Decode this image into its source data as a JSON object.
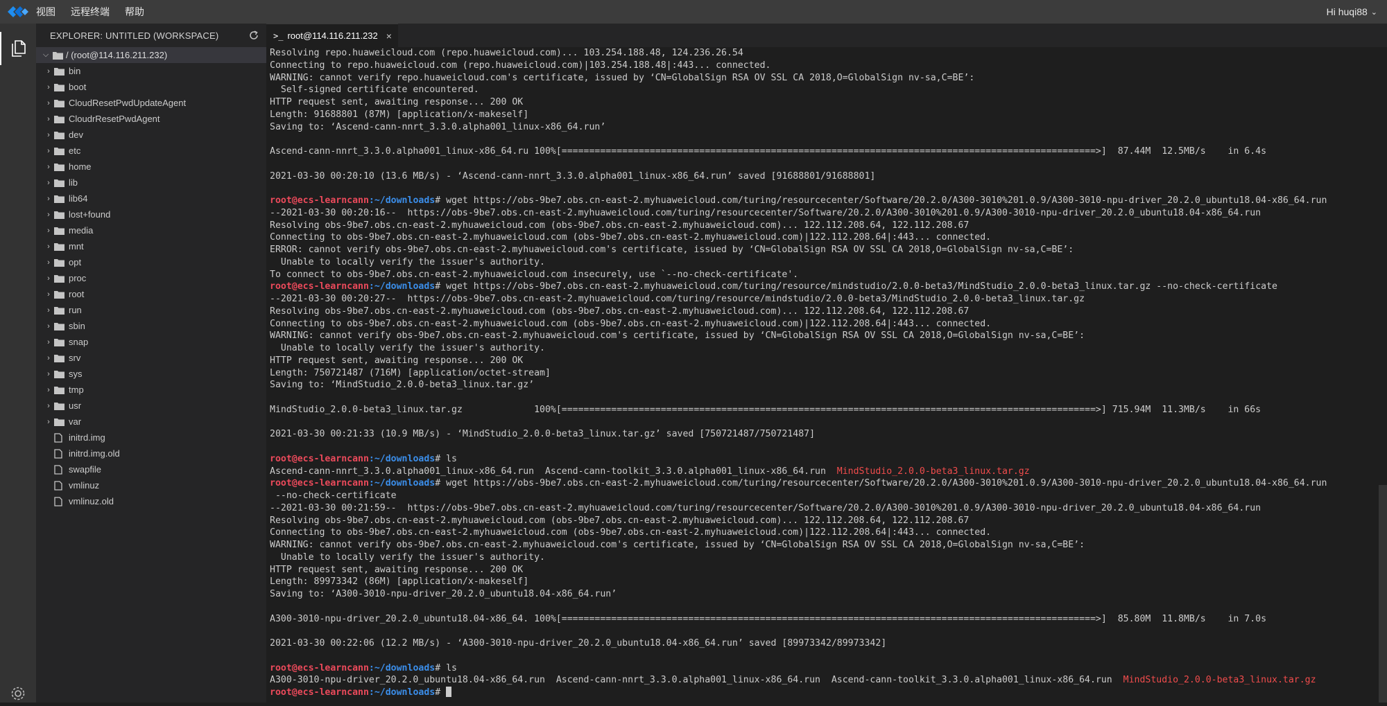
{
  "menu": [
    "视图",
    "远程终端",
    "帮助"
  ],
  "user_menu": "Hi huqi88",
  "explorer": {
    "title": "EXPLORER: UNTITLED (WORKSPACE)",
    "root": "/ (root@114.116.211.232)",
    "folders": [
      "bin",
      "boot",
      "CloudResetPwdUpdateAgent",
      "CloudrResetPwdAgent",
      "dev",
      "etc",
      "home",
      "lib",
      "lib64",
      "lost+found",
      "media",
      "mnt",
      "opt",
      "proc",
      "root",
      "run",
      "sbin",
      "snap",
      "srv",
      "sys",
      "tmp",
      "usr",
      "var"
    ],
    "files": [
      "initrd.img",
      "initrd.img.old",
      "swapfile",
      "vmlinuz",
      "vmlinuz.old"
    ]
  },
  "tab": {
    "label": "root@114.116.211.232",
    "icon": "terminal-icon"
  },
  "prompt": {
    "user": "root@ecs-learncann",
    "path": ":~/downloads",
    "symbol": "# "
  },
  "terminal": [
    {
      "text": "Resolving repo.huaweicloud.com (repo.huaweicloud.com)... 103.254.188.48, 124.236.26.54"
    },
    {
      "text": "Connecting to repo.huaweicloud.com (repo.huaweicloud.com)|103.254.188.48|:443... connected."
    },
    {
      "text": "WARNING: cannot verify repo.huaweicloud.com's certificate, issued by ‘CN=GlobalSign RSA OV SSL CA 2018,O=GlobalSign nv-sa,C=BE’:"
    },
    {
      "text": "  Self-signed certificate encountered."
    },
    {
      "text": "HTTP request sent, awaiting response... 200 OK"
    },
    {
      "text": "Length: 91688801 (87M) [application/x-makeself]"
    },
    {
      "text": "Saving to: ‘Ascend-cann-nnrt_3.3.0.alpha001_linux-x86_64.run’"
    },
    {
      "text": ""
    },
    {
      "text": "Ascend-cann-nnrt_3.3.0.alpha001_linux-x86_64.ru 100%[=================================================================================================>]  87.44M  12.5MB/s    in 6.4s"
    },
    {
      "text": ""
    },
    {
      "text": "2021-03-30 00:20:10 (13.6 MB/s) - ‘Ascend-cann-nnrt_3.3.0.alpha001_linux-x86_64.run’ saved [91688801/91688801]"
    },
    {
      "text": ""
    },
    {
      "prompt": true,
      "text": "wget https://obs-9be7.obs.cn-east-2.myhuaweicloud.com/turing/resourcecenter/Software/20.2.0/A300-3010%201.0.9/A300-3010-npu-driver_20.2.0_ubuntu18.04-x86_64.run"
    },
    {
      "text": "--2021-03-30 00:20:16--  https://obs-9be7.obs.cn-east-2.myhuaweicloud.com/turing/resourcecenter/Software/20.2.0/A300-3010%201.0.9/A300-3010-npu-driver_20.2.0_ubuntu18.04-x86_64.run"
    },
    {
      "text": "Resolving obs-9be7.obs.cn-east-2.myhuaweicloud.com (obs-9be7.obs.cn-east-2.myhuaweicloud.com)... 122.112.208.64, 122.112.208.67"
    },
    {
      "text": "Connecting to obs-9be7.obs.cn-east-2.myhuaweicloud.com (obs-9be7.obs.cn-east-2.myhuaweicloud.com)|122.112.208.64|:443... connected."
    },
    {
      "text": "ERROR: cannot verify obs-9be7.obs.cn-east-2.myhuaweicloud.com's certificate, issued by ‘CN=GlobalSign RSA OV SSL CA 2018,O=GlobalSign nv-sa,C=BE’:"
    },
    {
      "text": "  Unable to locally verify the issuer's authority."
    },
    {
      "text": "To connect to obs-9be7.obs.cn-east-2.myhuaweicloud.com insecurely, use `--no-check-certificate'."
    },
    {
      "prompt": true,
      "text": "wget https://obs-9be7.obs.cn-east-2.myhuaweicloud.com/turing/resource/mindstudio/2.0.0-beta3/MindStudio_2.0.0-beta3_linux.tar.gz --no-check-certificate"
    },
    {
      "text": "--2021-03-30 00:20:27--  https://obs-9be7.obs.cn-east-2.myhuaweicloud.com/turing/resource/mindstudio/2.0.0-beta3/MindStudio_2.0.0-beta3_linux.tar.gz"
    },
    {
      "text": "Resolving obs-9be7.obs.cn-east-2.myhuaweicloud.com (obs-9be7.obs.cn-east-2.myhuaweicloud.com)... 122.112.208.64, 122.112.208.67"
    },
    {
      "text": "Connecting to obs-9be7.obs.cn-east-2.myhuaweicloud.com (obs-9be7.obs.cn-east-2.myhuaweicloud.com)|122.112.208.64|:443... connected."
    },
    {
      "text": "WARNING: cannot verify obs-9be7.obs.cn-east-2.myhuaweicloud.com's certificate, issued by ‘CN=GlobalSign RSA OV SSL CA 2018,O=GlobalSign nv-sa,C=BE’:"
    },
    {
      "text": "  Unable to locally verify the issuer's authority."
    },
    {
      "text": "HTTP request sent, awaiting response... 200 OK"
    },
    {
      "text": "Length: 750721487 (716M) [application/octet-stream]"
    },
    {
      "text": "Saving to: ‘MindStudio_2.0.0-beta3_linux.tar.gz’"
    },
    {
      "text": ""
    },
    {
      "text": "MindStudio_2.0.0-beta3_linux.tar.gz             100%[=================================================================================================>] 715.94M  11.3MB/s    in 66s"
    },
    {
      "text": ""
    },
    {
      "text": "2021-03-30 00:21:33 (10.9 MB/s) - ‘MindStudio_2.0.0-beta3_linux.tar.gz’ saved [750721487/750721487]"
    },
    {
      "text": ""
    },
    {
      "prompt": true,
      "text": "ls"
    },
    {
      "text": "Ascend-cann-nnrt_3.3.0.alpha001_linux-x86_64.run  Ascend-cann-toolkit_3.3.0.alpha001_linux-x86_64.run  ",
      "red": "MindStudio_2.0.0-beta3_linux.tar.gz"
    },
    {
      "prompt": true,
      "text": "wget https://obs-9be7.obs.cn-east-2.myhuaweicloud.com/turing/resourcecenter/Software/20.2.0/A300-3010%201.0.9/A300-3010-npu-driver_20.2.0_ubuntu18.04-x86_64.run"
    },
    {
      "text": " --no-check-certificate"
    },
    {
      "text": "--2021-03-30 00:21:59--  https://obs-9be7.obs.cn-east-2.myhuaweicloud.com/turing/resourcecenter/Software/20.2.0/A300-3010%201.0.9/A300-3010-npu-driver_20.2.0_ubuntu18.04-x86_64.run"
    },
    {
      "text": "Resolving obs-9be7.obs.cn-east-2.myhuaweicloud.com (obs-9be7.obs.cn-east-2.myhuaweicloud.com)... 122.112.208.64, 122.112.208.67"
    },
    {
      "text": "Connecting to obs-9be7.obs.cn-east-2.myhuaweicloud.com (obs-9be7.obs.cn-east-2.myhuaweicloud.com)|122.112.208.64|:443... connected."
    },
    {
      "text": "WARNING: cannot verify obs-9be7.obs.cn-east-2.myhuaweicloud.com's certificate, issued by ‘CN=GlobalSign RSA OV SSL CA 2018,O=GlobalSign nv-sa,C=BE’:"
    },
    {
      "text": "  Unable to locally verify the issuer's authority."
    },
    {
      "text": "HTTP request sent, awaiting response... 200 OK"
    },
    {
      "text": "Length: 89973342 (86M) [application/x-makeself]"
    },
    {
      "text": "Saving to: ‘A300-3010-npu-driver_20.2.0_ubuntu18.04-x86_64.run’"
    },
    {
      "text": ""
    },
    {
      "text": "A300-3010-npu-driver_20.2.0_ubuntu18.04-x86_64. 100%[=================================================================================================>]  85.80M  11.8MB/s    in 7.0s"
    },
    {
      "text": ""
    },
    {
      "text": "2021-03-30 00:22:06 (12.2 MB/s) - ‘A300-3010-npu-driver_20.2.0_ubuntu18.04-x86_64.run’ saved [89973342/89973342]"
    },
    {
      "text": ""
    },
    {
      "prompt": true,
      "text": "ls"
    },
    {
      "text": "A300-3010-npu-driver_20.2.0_ubuntu18.04-x86_64.run  Ascend-cann-nnrt_3.3.0.alpha001_linux-x86_64.run  Ascend-cann-toolkit_3.3.0.alpha001_linux-x86_64.run  ",
      "red": "MindStudio_2.0.0-beta3_linux.tar.gz"
    },
    {
      "prompt": true,
      "text": "",
      "cursor": true
    }
  ],
  "colors": {
    "prompt_user": "#ec4a5b",
    "prompt_path": "#3b8eea",
    "archive": "#f14c4c"
  }
}
